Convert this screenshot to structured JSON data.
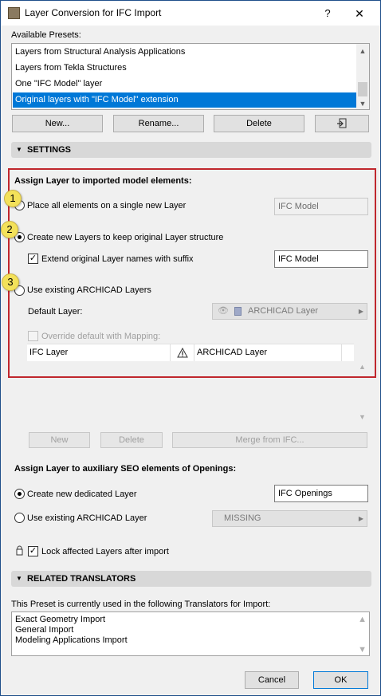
{
  "window": {
    "title": "Layer Conversion for IFC Import",
    "help": "?",
    "close": "✕"
  },
  "presets": {
    "label": "Available Presets:",
    "items": [
      "Layers from Structural Analysis Applications",
      "Layers from Tekla Structures",
      "One \"IFC Model\" layer",
      "Original layers with \"IFC Model\" extension"
    ],
    "selected_index": 3,
    "buttons": {
      "new": "New...",
      "rename": "Rename...",
      "delete": "Delete"
    }
  },
  "settings": {
    "header": "SETTINGS",
    "assign_heading": "Assign Layer to imported model elements:",
    "option1": {
      "badge": "1",
      "label": "Place all elements on a single new Layer",
      "value": "IFC Model",
      "checked": false
    },
    "option2": {
      "badge": "2",
      "label": "Create new Layers to keep original Layer structure",
      "checked": true,
      "suffix_label": "Extend original Layer names with suffix",
      "suffix_value": "IFC Model",
      "suffix_checked": true
    },
    "option3": {
      "badge": "3",
      "label": "Use existing ARCHICAD Layers",
      "checked": false,
      "default_layer_label": "Default Layer:",
      "default_layer_value": "ARCHICAD Layer",
      "override_label": "Override default with Mapping:"
    },
    "mapping_table": {
      "col1": "IFC Layer",
      "col2": "ARCHICAD Layer",
      "warning_icon": "warning-icon"
    },
    "mapping_buttons": {
      "new": "New",
      "delete": "Delete",
      "merge": "Merge from IFC..."
    },
    "seo_heading": "Assign Layer to auxiliary SEO elements of Openings:",
    "seo_option1": {
      "label": "Create new dedicated Layer",
      "value": "IFC Openings",
      "checked": true
    },
    "seo_option2": {
      "label": "Use existing ARCHICAD Layer",
      "value": "MISSING",
      "checked": false
    },
    "lock_label": "Lock affected Layers after import"
  },
  "translators": {
    "header": "RELATED TRANSLATORS",
    "description": "This Preset is currently used in the following Translators for Import:",
    "items": [
      "Exact Geometry Import",
      "General Import",
      "Modeling Applications Import"
    ]
  },
  "footer": {
    "cancel": "Cancel",
    "ok": "OK"
  },
  "colors": {
    "selection": "#0078d7",
    "highlight_box": "#c0272d",
    "badge": "#f3e15a"
  }
}
